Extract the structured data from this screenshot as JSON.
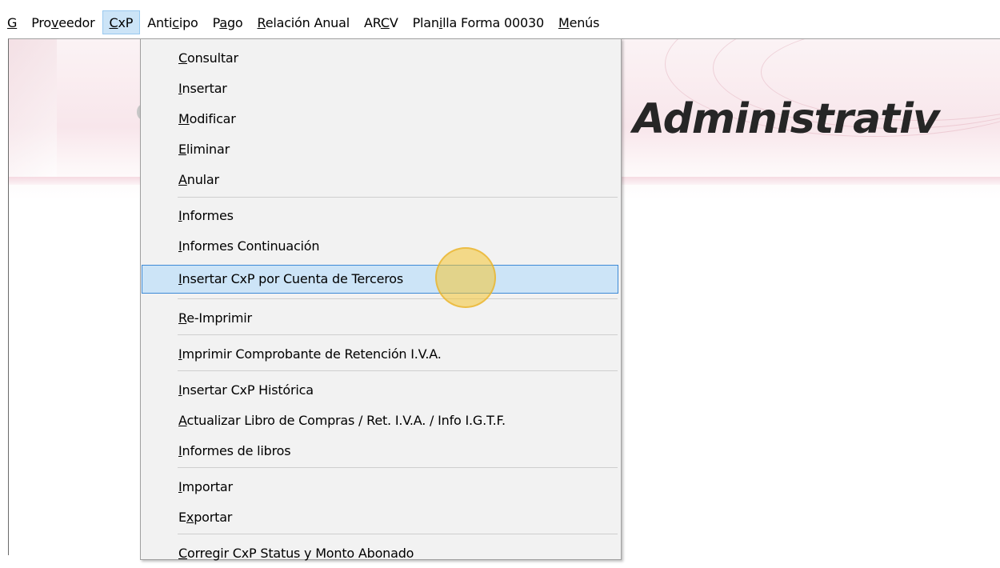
{
  "menubar": {
    "items": [
      {
        "pre": "",
        "key": "G",
        "post": ""
      },
      {
        "pre": "Pro",
        "key": "v",
        "post": "eedor"
      },
      {
        "pre": "",
        "key": "C",
        "post": "xP"
      },
      {
        "pre": "Anti",
        "key": "c",
        "post": "ipo"
      },
      {
        "pre": "P",
        "key": "a",
        "post": "go"
      },
      {
        "pre": "",
        "key": "R",
        "post": "elación Anual"
      },
      {
        "pre": "AR",
        "key": "C",
        "post": "V"
      },
      {
        "pre": "Plan",
        "key": "i",
        "post": "lla Forma 00030"
      },
      {
        "pre": "",
        "key": "M",
        "post": "enús"
      }
    ]
  },
  "banner": {
    "title": "Administrativ"
  },
  "cxp_menu": {
    "items": [
      {
        "pre": "",
        "key": "C",
        "post": "onsultar"
      },
      {
        "pre": "",
        "key": "I",
        "post": "nsertar"
      },
      {
        "pre": "",
        "key": "M",
        "post": "odificar"
      },
      {
        "pre": "",
        "key": "E",
        "post": "liminar"
      },
      {
        "pre": "",
        "key": "A",
        "post": "nular"
      },
      {
        "pre": "",
        "key": "I",
        "post": "nformes"
      },
      {
        "pre": "",
        "key": "I",
        "post": "nformes Continuación"
      },
      {
        "pre": "",
        "key": "I",
        "post": "nsertar CxP por Cuenta de Terceros"
      },
      {
        "pre": "",
        "key": "R",
        "post": "e-Imprimir"
      },
      {
        "pre": "",
        "key": "I",
        "post": "mprimir Comprobante de Retención I.V.A."
      },
      {
        "pre": "",
        "key": "I",
        "post": "nsertar CxP Histórica"
      },
      {
        "pre": "",
        "key": "A",
        "post": "ctualizar Libro de Compras / Ret. I.V.A. / Info I.G.T.F."
      },
      {
        "pre": "",
        "key": "I",
        "post": "nformes de libros"
      },
      {
        "pre": "",
        "key": "I",
        "post": "mportar"
      },
      {
        "pre": "E",
        "key": "x",
        "post": "portar"
      },
      {
        "pre": "",
        "key": "C",
        "post": "orregir CxP Status y Monto Abonado"
      }
    ]
  },
  "colors": {
    "highlight": "#cce4f7",
    "highlight_border": "#3d8ad6",
    "cursor": "#f4c432"
  }
}
